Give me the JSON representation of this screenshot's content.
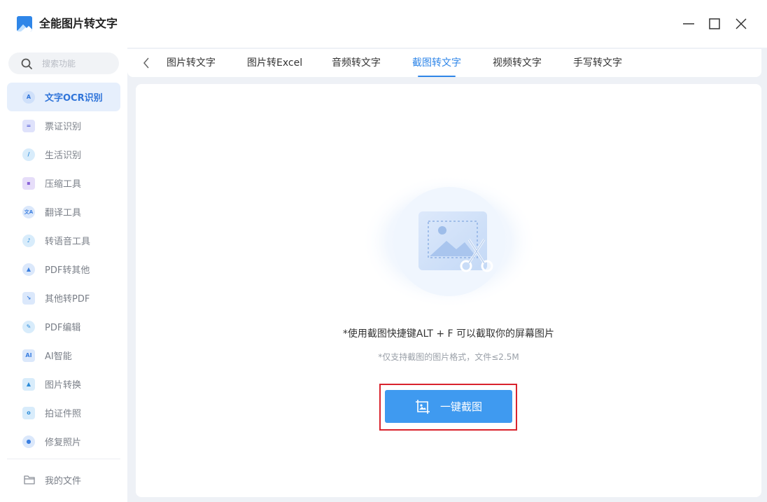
{
  "app": {
    "title": "全能图片转文字",
    "logo_icon": "image-logo-icon",
    "brand_color": "#2f86e8"
  },
  "window_controls": [
    "minimize-icon",
    "maximize-icon",
    "close-icon"
  ],
  "sidebar": {
    "search": {
      "placeholder": "搜索功能",
      "value": ""
    },
    "items": [
      {
        "label": "文字OCR识别",
        "icon": "A",
        "active": true
      },
      {
        "label": "票证识别",
        "icon": "="
      },
      {
        "label": "生活识别",
        "icon": "/"
      },
      {
        "label": "压缩工具",
        "icon": "▪"
      },
      {
        "label": "翻译工具",
        "icon": "文A"
      },
      {
        "label": "转语音工具",
        "icon": "♪"
      },
      {
        "label": "PDF转其他",
        "icon": "▲"
      },
      {
        "label": "其他转PDF",
        "icon": "↘"
      },
      {
        "label": "PDF编辑",
        "icon": "✎"
      },
      {
        "label": "AI智能",
        "icon": "AI"
      },
      {
        "label": "图片转换",
        "icon": "▲"
      },
      {
        "label": "拍证件照",
        "icon": "o"
      },
      {
        "label": "修复照片",
        "icon": "●"
      }
    ],
    "files_label": "我的文件"
  },
  "tabs": [
    {
      "label": "图片转文字"
    },
    {
      "label": "图片转Excel"
    },
    {
      "label": "音频转文字"
    },
    {
      "label": "截图转文字",
      "active": true
    },
    {
      "label": "视频转文字"
    },
    {
      "label": "手写转文字"
    }
  ],
  "content": {
    "hint_main": "*使用截图快捷键ALT + F 可以截取你的屏幕图片",
    "hint_sub": "*仅支持截图的图片格式，文件≤2.5M",
    "capture_button": "一键截图",
    "accent_color": "#3f9af0",
    "highlight_color": "#d9232d"
  }
}
